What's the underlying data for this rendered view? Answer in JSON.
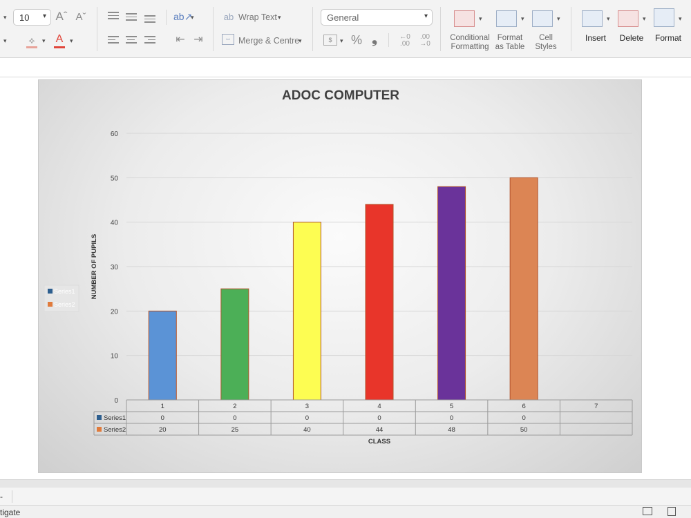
{
  "ribbon": {
    "font_size": "10",
    "wrap_text": "Wrap Text",
    "merge_centre": "Merge & Centre",
    "number_format": "General",
    "percent_symbol": "%",
    "comma_symbol": "❟",
    "conditional_formatting": "Conditional\nFormatting",
    "format_as_table": "Format\nas Table",
    "cell_styles": "Cell\nStyles",
    "insert": "Insert",
    "delete": "Delete",
    "format": "Format",
    "fill_color": "#e8a39a",
    "font_color": "#e0463b"
  },
  "status": {
    "text": "tigate"
  },
  "chart_data": {
    "type": "bar",
    "title": "ADOC COMPUTER",
    "xlabel": "CLASS",
    "ylabel": "NUMBER OF PUPILS",
    "ylim": [
      0,
      60
    ],
    "yticks": [
      "0",
      "10",
      "20",
      "30",
      "40",
      "50",
      "60"
    ],
    "categories": [
      "1",
      "2",
      "3",
      "4",
      "5",
      "6",
      "7"
    ],
    "series": [
      {
        "name": "Series1",
        "values": [
          0,
          0,
          0,
          0,
          0,
          0,
          null
        ],
        "labels": [
          "0",
          "0",
          "0",
          "0",
          "0",
          "0",
          ""
        ],
        "color": "#2e5f8f"
      },
      {
        "name": "Series2",
        "values": [
          20,
          25,
          40,
          44,
          48,
          50,
          null
        ],
        "labels": [
          "20",
          "25",
          "40",
          "44",
          "48",
          "50",
          ""
        ],
        "color": "#e07b3c"
      }
    ],
    "bar_colors": [
      "#5b93d6",
      "#4caf57",
      "#fdfd52",
      "#e8352a",
      "#6a339a",
      "#dc8554"
    ],
    "bar_border": "#b2532a",
    "legend": [
      "Series1",
      "Series2"
    ],
    "grid": true,
    "data_table": true
  }
}
